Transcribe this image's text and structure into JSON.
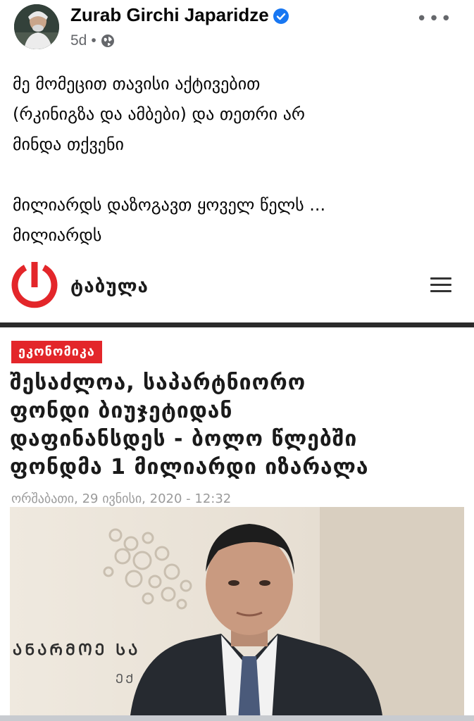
{
  "post": {
    "author": "Zurab Girchi Japaridze",
    "time": "5d",
    "separator": "•",
    "more_label": "•••",
    "text_lines_1": [
      "მე მომეცით თავისი აქტივებით",
      "(რკინიგზა და ამბები) და თეთრი არ",
      "მინდა თქვენი"
    ],
    "text_lines_2": [
      "მილიარდს დაზოგავთ ყოველ წელს ...",
      "მილიარდს"
    ]
  },
  "article": {
    "site_name": "ტაბულა",
    "category": "ეკონომიკა",
    "headline_lines": [
      "შესაძლოა, საპარტნიორო",
      "ფონდი ბიუჯეტიდან",
      "დაფინანსდეს - ბოლო წლებში",
      "ფონდმა 1 მილიარდი იზარალა"
    ],
    "date": "ორშაბათი, 29 ივნისი, 2020 - 12:32",
    "photo_sign_text": "ᲐᲜᲐᲠᲛᲝᲔ ᲡᲐ",
    "photo_sign_text_2": "ᲔᲥ"
  },
  "colors": {
    "brand_red": "#e3262a",
    "verified_blue": "#1877f2",
    "meta_gray": "#65676b"
  },
  "icons": {
    "verified": "verified-badge-icon",
    "globe": "globe-icon",
    "menu": "hamburger-menu-icon",
    "logo": "tabula-logo-icon"
  }
}
